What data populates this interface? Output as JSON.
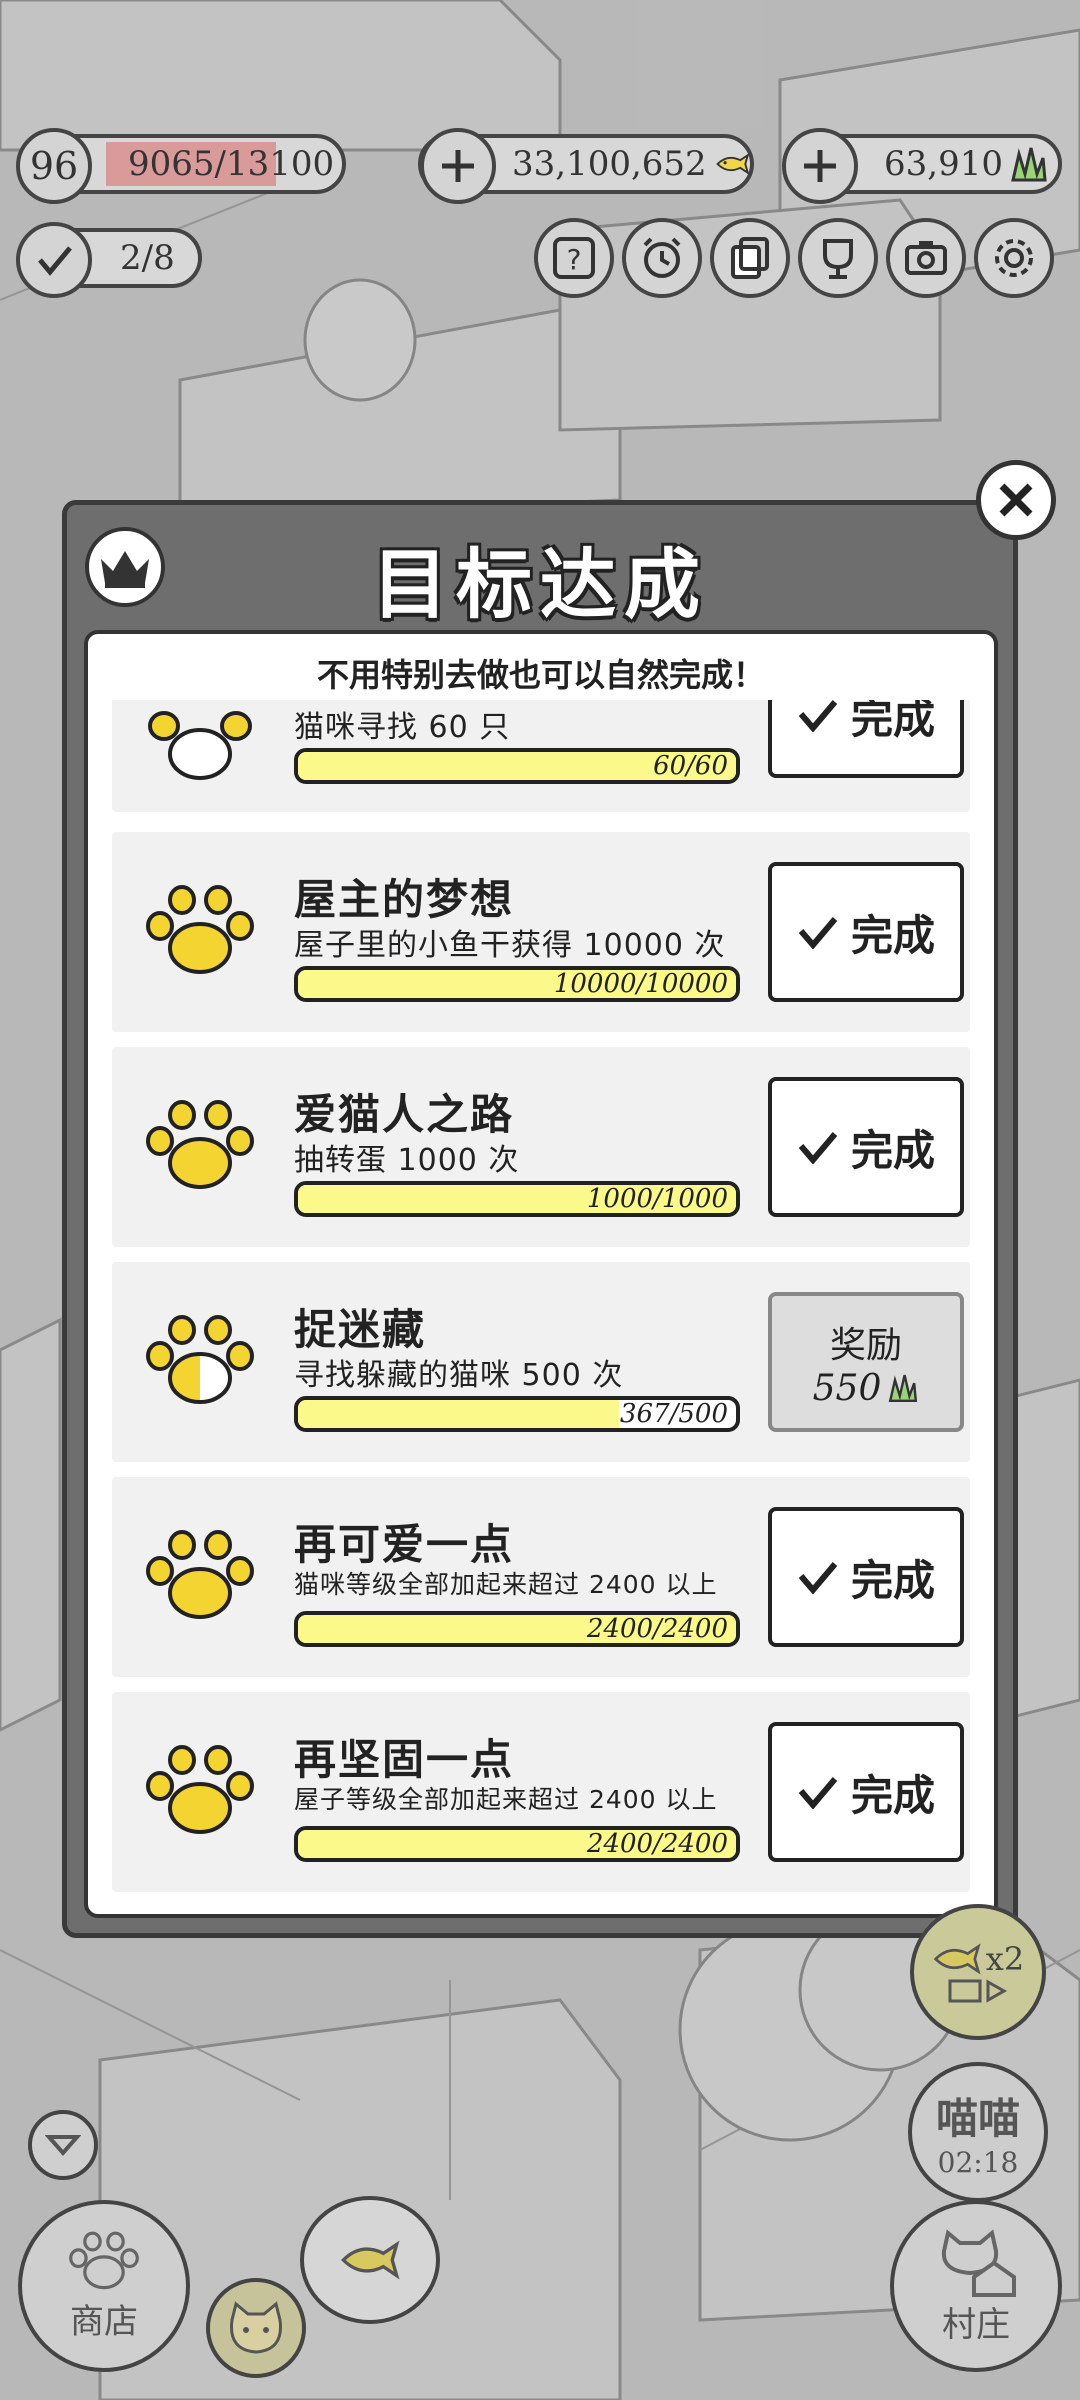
{
  "hud": {
    "level": "96",
    "exp": "9065/13100",
    "exp_fraction": 0.69,
    "coins": "33,100,652",
    "grass": "63,910",
    "tasks": "2/8"
  },
  "toolbar_icons": [
    "help-icon",
    "alarm-clock-icon",
    "cards-icon",
    "trophy-icon",
    "camera-icon",
    "settings-icon"
  ],
  "modal": {
    "title": "目标达成",
    "subtitle": "不用特别去做也可以自然完成！",
    "items": [
      {
        "title": "",
        "desc": "猫咪寻找 60 只",
        "progress": "60/60",
        "fraction": 1.0,
        "status": "完成"
      },
      {
        "title": "屋主的梦想",
        "desc": "屋子里的小鱼干获得 10000 次",
        "progress": "10000/10000",
        "fraction": 1.0,
        "status": "完成"
      },
      {
        "title": "爱猫人之路",
        "desc": "抽转蛋 1000 次",
        "progress": "1000/1000",
        "fraction": 1.0,
        "status": "完成"
      },
      {
        "title": "捉迷藏",
        "desc": "寻找躲藏的猫咪 500 次",
        "progress": "367/500",
        "fraction": 0.734,
        "status": "奖励",
        "reward": "550"
      },
      {
        "title": "再可爱一点",
        "desc": "猫咪等级全部加起来超过 2400 以上",
        "progress": "2400/2400",
        "fraction": 1.0,
        "status": "完成"
      },
      {
        "title": "再坚固一点",
        "desc": "屋子等级全部加起来超过 2400 以上",
        "progress": "2400/2400",
        "fraction": 1.0,
        "status": "完成"
      }
    ]
  },
  "side": {
    "multiplier": "x2",
    "meow_label": "喵喵",
    "meow_timer": "02:18"
  },
  "bottom": {
    "shop_label": "商店",
    "village_label": "村庄"
  },
  "colors": {
    "bar_fill": "#fbf98a",
    "paw_yellow": "#f4d430",
    "grass_green": "#8fd06a",
    "exp_red": "#e08a8a"
  }
}
